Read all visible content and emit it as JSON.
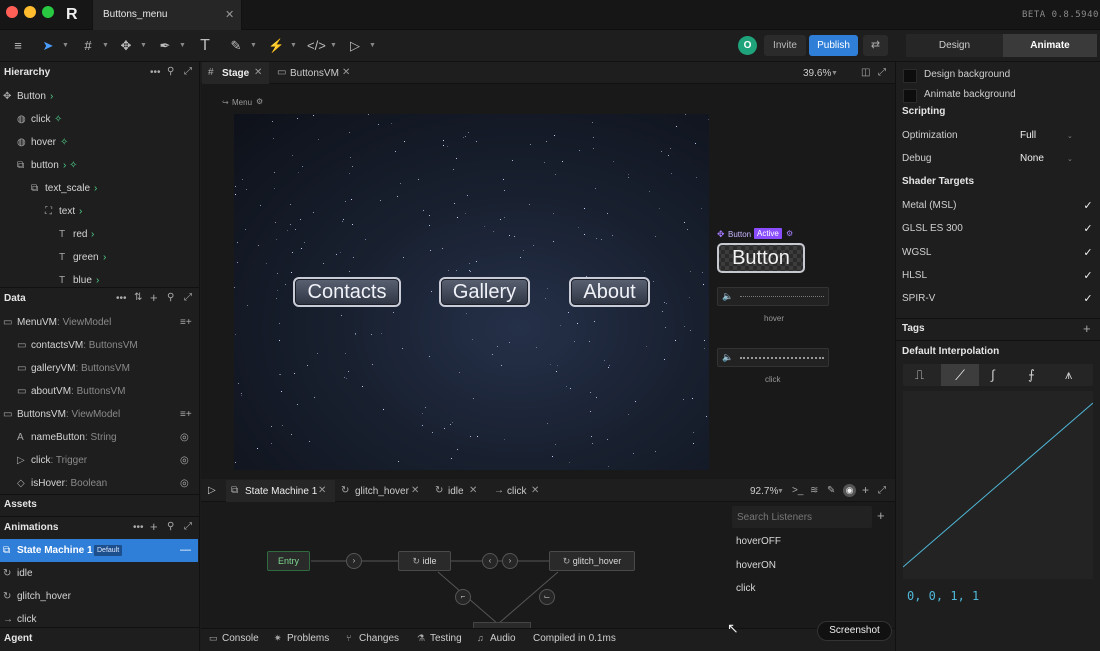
{
  "title_bar": {
    "document_tab": "Buttons_menu",
    "version": "BETA 0.8.5940"
  },
  "toolbar": {
    "avatar_letter": "O",
    "invite": "Invite",
    "publish": "Publish",
    "mode_design": "Design",
    "mode_animate": "Animate"
  },
  "hierarchy": {
    "title": "Hierarchy",
    "items": [
      {
        "label": "Button",
        "suffix": "›"
      },
      {
        "label": "click",
        "suffix": "✧"
      },
      {
        "label": "hover",
        "suffix": "✧"
      },
      {
        "label": "button",
        "suffix": "› ✧"
      },
      {
        "label": "text_scale",
        "suffix": "›"
      },
      {
        "label": "text",
        "suffix": "›"
      },
      {
        "label": "red",
        "suffix": "›"
      },
      {
        "label": "green",
        "suffix": "›"
      },
      {
        "label": "blue",
        "suffix": "›"
      }
    ]
  },
  "data_panel": {
    "title": "Data",
    "items": [
      {
        "name": "MenuVM",
        "type": ": ViewModel"
      },
      {
        "name": "contactsVM",
        "type": ": ButtonsVM"
      },
      {
        "name": "galleryVM",
        "type": ": ButtonsVM"
      },
      {
        "name": "aboutVM",
        "type": ": ButtonsVM"
      },
      {
        "name": "ButtonsVM",
        "type": ": ViewModel"
      },
      {
        "name": "nameButton",
        "type": ": String"
      },
      {
        "name": "click",
        "type": ": Trigger"
      },
      {
        "name": "isHover",
        "type": ": Boolean"
      }
    ]
  },
  "assets": {
    "title": "Assets"
  },
  "animations": {
    "title": "Animations",
    "items": [
      {
        "label": "State Machine 1",
        "badge": "Default"
      },
      {
        "label": "idle"
      },
      {
        "label": "glitch_hover"
      },
      {
        "label": "click"
      }
    ]
  },
  "agent": {
    "title": "Agent"
  },
  "stage": {
    "tabs": [
      "Stage",
      "ButtonsVM"
    ],
    "zoom": "39.6%",
    "artboard_label": "Menu",
    "menu_buttons": [
      "Contacts",
      "Gallery",
      "About"
    ],
    "component": {
      "name": "Button",
      "state": "Active",
      "preview_text": "Button",
      "inputs": [
        "hover",
        "click"
      ]
    }
  },
  "state_machine": {
    "tabs": [
      "State Machine 1",
      "glitch_hover",
      "idle",
      "click"
    ],
    "zoom": "92.7%",
    "nodes": [
      "Entry",
      "idle",
      "glitch_hover"
    ],
    "listener_search_placeholder": "Search Listeners",
    "listeners": [
      "hoverOFF",
      "hoverON",
      "click"
    ]
  },
  "status_bar": {
    "tabs": [
      "Console",
      "Problems",
      "Changes",
      "Testing",
      "Audio"
    ],
    "status": "Compiled in 0.1ms",
    "tooltip": "Screenshot"
  },
  "right_panel": {
    "design_background": "Design background",
    "animate_background": "Animate background",
    "scripting_title": "Scripting",
    "optimization_label": "Optimization",
    "optimization_value": "Full",
    "debug_label": "Debug",
    "debug_value": "None",
    "shader_targets_title": "Shader Targets",
    "shader_targets": [
      "Metal (MSL)",
      "GLSL ES 300",
      "WGSL",
      "HLSL",
      "SPIR-V"
    ],
    "tags_title": "Tags",
    "interp_title": "Default Interpolation",
    "bezier_values": "0, 0, 1, 1",
    "accent": "#4fb8d8"
  }
}
